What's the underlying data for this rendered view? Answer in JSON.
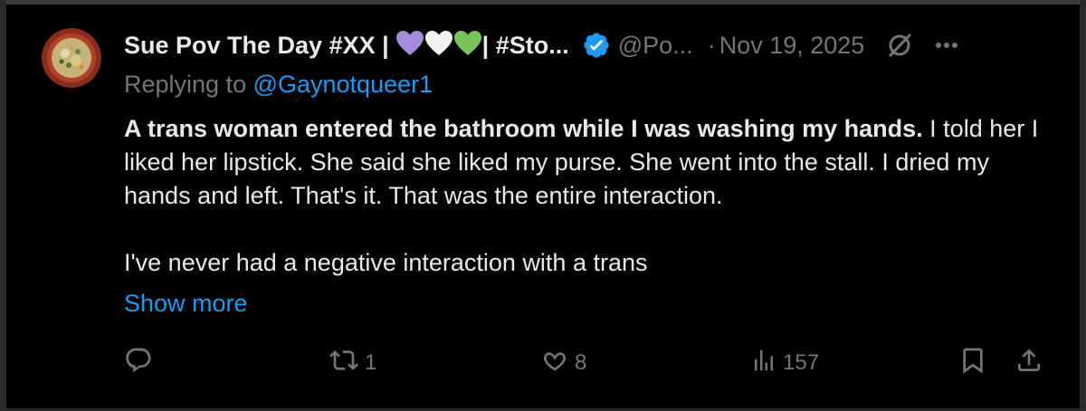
{
  "tweet": {
    "display_name": "Sue Pov The Day #XX |",
    "name_tail": "| #Sto...",
    "emoji_hearts": [
      "purple-heart",
      "white-heart",
      "green-heart"
    ],
    "handle": "@Po...",
    "separator": "·",
    "date": "Nov 19, 2025",
    "replying_prefix": "Replying to ",
    "replying_to": "@Gaynotqueer1",
    "text_bold": "A trans woman entered the bathroom while I was washing my hands.",
    "text_rest": " I told her I liked her lipstick.  She said she liked my purse.  She went into the stall. I dried my hands and left. That's it.  That was the entire interaction.",
    "text_second": "I've never had a negative interaction with a trans",
    "show_more": "Show more"
  },
  "actions": {
    "reply_count": "",
    "retweet_count": "1",
    "like_count": "8",
    "views_count": "157"
  },
  "colors": {
    "background": "#000000",
    "text": "#e7e9ea",
    "muted": "#71767b",
    "link": "#1d9bf0",
    "verified": "#1d9bf0"
  },
  "icons": [
    "reply-icon",
    "retweet-icon",
    "heart-icon",
    "views-icon",
    "bookmark-icon",
    "share-icon",
    "verified-icon",
    "grok-icon",
    "more-icon"
  ]
}
